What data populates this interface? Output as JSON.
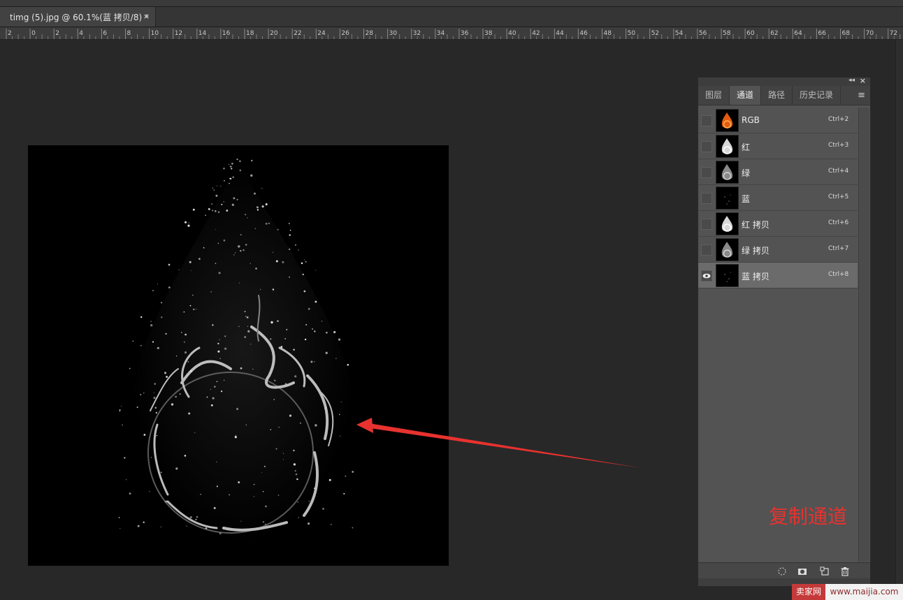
{
  "document_tab": {
    "title": "timg (5).jpg @ 60.1%(蓝 拷贝/8) *",
    "close": "×"
  },
  "ruler": {
    "labels": [
      "2",
      "0",
      "2",
      "4",
      "6",
      "8",
      "10",
      "12",
      "14",
      "16",
      "18",
      "20",
      "22",
      "24",
      "26",
      "28",
      "30",
      "32",
      "34",
      "36",
      "38",
      "40",
      "42",
      "44",
      "46",
      "48",
      "50",
      "52",
      "54",
      "56",
      "58",
      "60",
      "62",
      "64",
      "66",
      "68",
      "70",
      "72"
    ]
  },
  "panel": {
    "collapse_icon": "double-arrow-icon",
    "tabs": [
      {
        "label": "图层",
        "active": false
      },
      {
        "label": "通道",
        "active": true
      },
      {
        "label": "路径",
        "active": false
      },
      {
        "label": "历史记录",
        "active": false
      }
    ],
    "channels": [
      {
        "name": "RGB",
        "shortcut": "Ctrl+2",
        "visible": false,
        "selected": false
      },
      {
        "name": "红",
        "shortcut": "Ctrl+3",
        "visible": false,
        "selected": false
      },
      {
        "name": "绿",
        "shortcut": "Ctrl+4",
        "visible": false,
        "selected": false
      },
      {
        "name": "蓝",
        "shortcut": "Ctrl+5",
        "visible": false,
        "selected": false
      },
      {
        "name": "红 拷贝",
        "shortcut": "Ctrl+6",
        "visible": false,
        "selected": false
      },
      {
        "name": "绿 拷贝",
        "shortcut": "Ctrl+7",
        "visible": false,
        "selected": false
      },
      {
        "name": "蓝 拷贝",
        "shortcut": "Ctrl+8",
        "visible": true,
        "selected": true
      }
    ],
    "bottom_icons": [
      "load-selection-icon",
      "save-mask-icon",
      "new-channel-icon",
      "delete-icon"
    ]
  },
  "annotation": {
    "text": "复制通道",
    "color": "#e8322f"
  },
  "watermark": {
    "left": "卖家网",
    "right": "www.maijia.com"
  },
  "colors": {
    "workspace": "#282828",
    "panel": "#535353",
    "selected_row": "#6b6b6b",
    "accent_red": "#e8322f"
  }
}
